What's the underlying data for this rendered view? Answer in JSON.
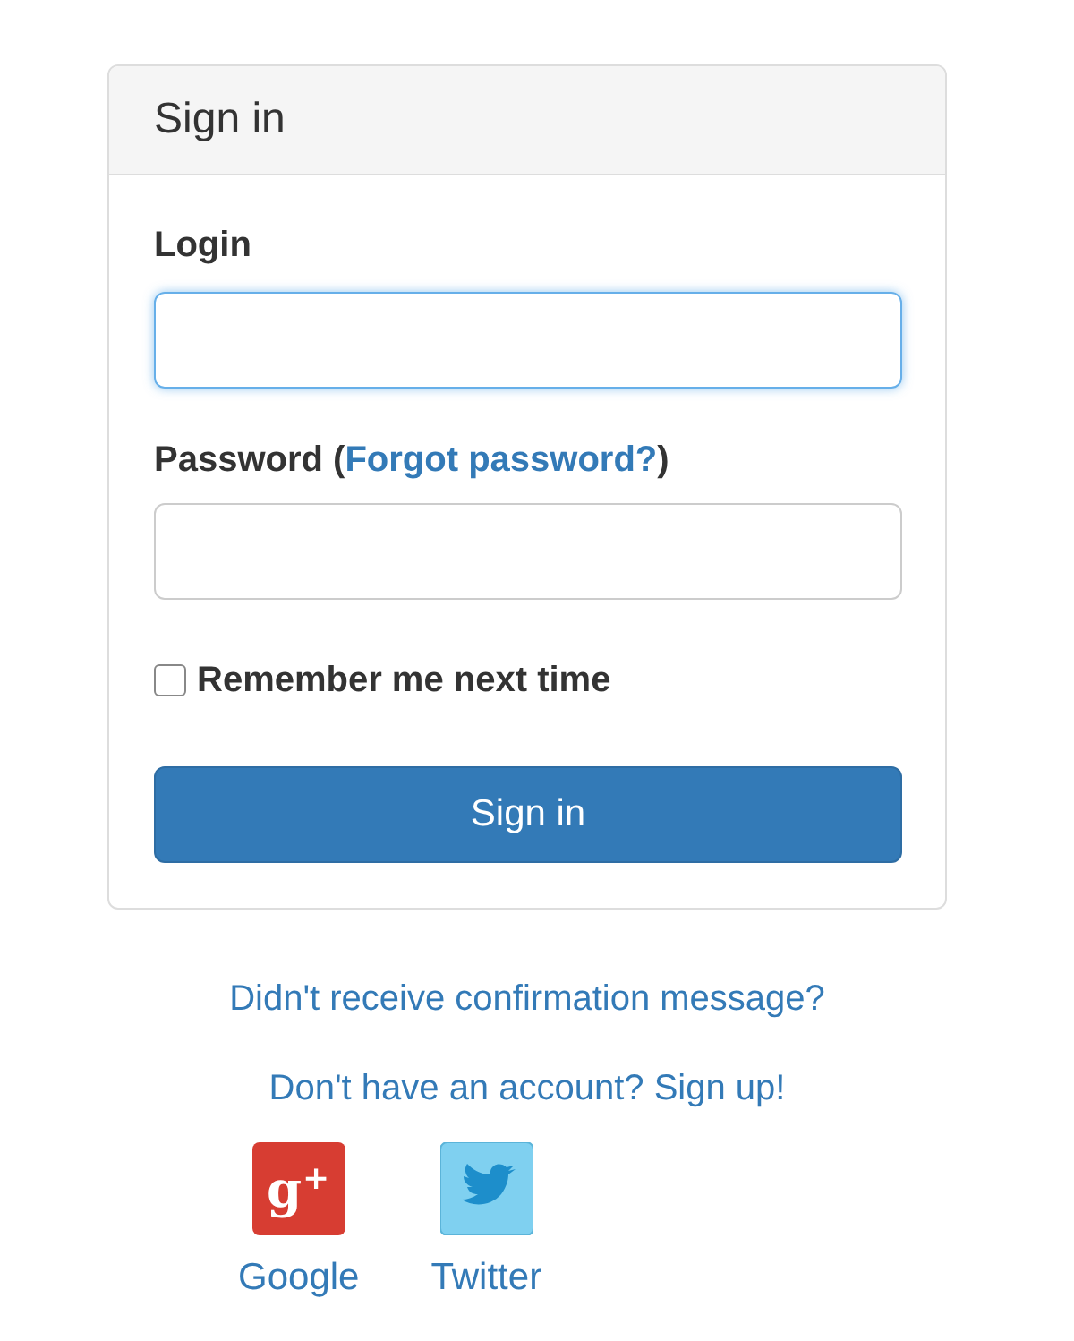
{
  "panel": {
    "title": "Sign in"
  },
  "login": {
    "label": "Login",
    "focused": true
  },
  "password": {
    "label_start": "Password (",
    "forgot_link": "Forgot password?",
    "label_end": ")",
    "focused": false
  },
  "remember": {
    "label": "Remember me next time",
    "checked": false
  },
  "submit": {
    "label": "Sign in"
  },
  "links": [
    "Didn't receive confirmation message?",
    "Don't have an account? Sign up!"
  ],
  "social": [
    {
      "kind": "google",
      "label": "Google",
      "logo_letter": "g",
      "logo_mark": "+"
    },
    {
      "kind": "twitter",
      "label": "Twitter"
    }
  ]
}
